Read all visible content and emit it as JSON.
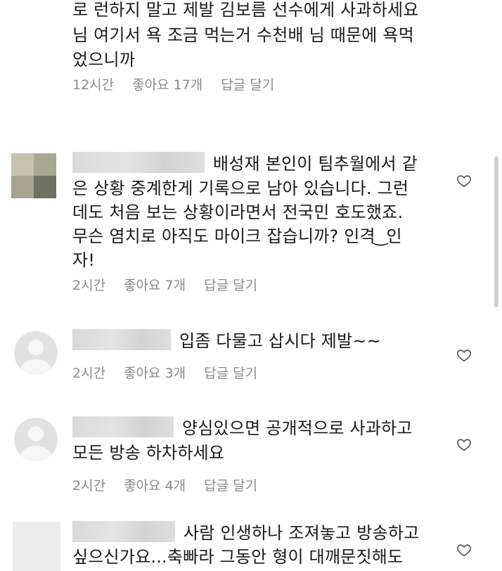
{
  "comments": [
    {
      "lines": [
        "로 런하지 말고 제발 김보름 선수에게 사과하세요",
        "님 여기서 욕 조금 먹는거 수천배 님 때문에 욕먹",
        "었으니까"
      ],
      "time": "12시간",
      "likes": "좋아요 17개",
      "reply": "답글 달기"
    },
    {
      "lines": [
        "배성재 본인이 팀추월에서 같",
        "은 상황 중계한게 기록으로 남아 있습니다. 그런",
        "데도 처음 보는 상황이라면서 전국민 호도했죠.",
        "무슨 염치로 아직도 마이크 잡습니까? 인격 ͜ 인",
        "자!"
      ],
      "time": "2시간",
      "likes": "좋아요 7개",
      "reply": "답글 달기"
    },
    {
      "lines": [
        "입좀 다물고 삽시다 제발~~"
      ],
      "time": "2시간",
      "likes": "좋아요 3개",
      "reply": "답글 달기"
    },
    {
      "lines": [
        "양심있으면 공개적으로 사과하고",
        "모든 방송 하차하세요"
      ],
      "time": "2시간",
      "likes": "좋아요 4개",
      "reply": "답글 달기"
    },
    {
      "lines": [
        "사람 인생하나 조져놓고 방송하고",
        "싶으신가요...축빠라 그동안 형이 대깨문짓해도"
      ]
    }
  ],
  "colors": {
    "text": "#1a1a1a",
    "meta": "#8a8a8a",
    "heart": "#555555"
  },
  "icons": {
    "like": "heart-outline-icon",
    "avatar_default": "default-avatar-icon"
  }
}
